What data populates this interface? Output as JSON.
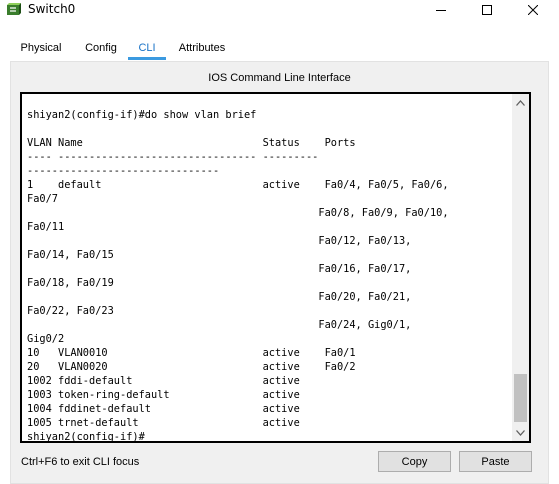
{
  "window": {
    "title": "Switch0",
    "icon": "switch-app-icon"
  },
  "tabs": [
    {
      "label": "Physical"
    },
    {
      "label": "Config"
    },
    {
      "label": "CLI",
      "active": true
    },
    {
      "label": "Attributes"
    }
  ],
  "panel": {
    "caption": "IOS Command Line Interface"
  },
  "console": {
    "lines": [
      "shiyan2(config-if)#do show vlan brief",
      "",
      "VLAN Name                             Status    Ports",
      "---- -------------------------------- ---------",
      "-------------------------------",
      "1    default                          active    Fa0/4, Fa0/5, Fa0/6,",
      "Fa0/7",
      "                                               Fa0/8, Fa0/9, Fa0/10,",
      "Fa0/11",
      "                                               Fa0/12, Fa0/13,",
      "Fa0/14, Fa0/15",
      "                                               Fa0/16, Fa0/17,",
      "Fa0/18, Fa0/19",
      "                                               Fa0/20, Fa0/21,",
      "Fa0/22, Fa0/23",
      "                                               Fa0/24, Gig0/1,",
      "Gig0/2",
      "10   VLAN0010                         active    Fa0/1",
      "20   VLAN0020                         active    Fa0/2",
      "1002 fddi-default                     active",
      "1003 token-ring-default               active",
      "1004 fddinet-default                  active",
      "1005 trnet-default                    active",
      "shiyan2(config-if)#"
    ]
  },
  "footer": {
    "hint": "Ctrl+F6 to exit CLI focus",
    "copy_label": "Copy",
    "paste_label": "Paste"
  },
  "colors": {
    "active_tab": "#1a73c7",
    "active_tab_underline": "#3b9ae0",
    "panel_bg": "#f0f0f0",
    "console_border": "#000000"
  }
}
